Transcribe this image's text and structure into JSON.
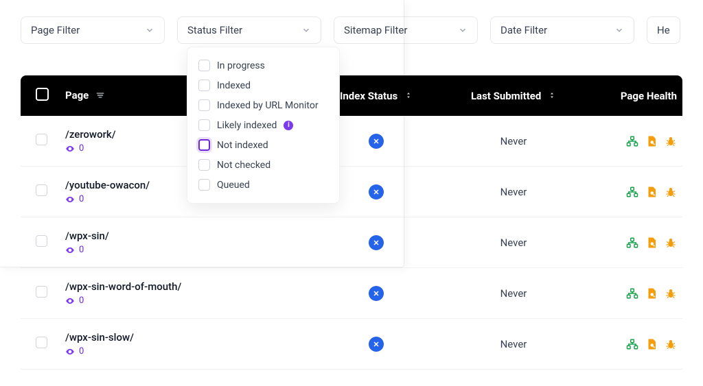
{
  "filters": {
    "page": "Page Filter",
    "status": "Status Filter",
    "sitemap": "Sitemap Filter",
    "date": "Date Filter",
    "extra": "He"
  },
  "status_options": [
    {
      "label": "In progress",
      "focused": false,
      "info": false
    },
    {
      "label": "Indexed",
      "focused": false,
      "info": false
    },
    {
      "label": "Indexed by URL Monitor",
      "focused": false,
      "info": false
    },
    {
      "label": "Likely indexed",
      "focused": false,
      "info": true
    },
    {
      "label": "Not indexed",
      "focused": true,
      "info": false
    },
    {
      "label": "Not checked",
      "focused": false,
      "info": false
    },
    {
      "label": "Queued",
      "focused": false,
      "info": false
    }
  ],
  "columns": {
    "page": "Page",
    "index_status": "Index Status",
    "last_submitted": "Last Submitted",
    "page_health": "Page Health"
  },
  "rows": [
    {
      "path": "/zerowork/",
      "views": "0",
      "last_submitted": "Never"
    },
    {
      "path": "/youtube-owacon/",
      "views": "0",
      "last_submitted": "Never"
    },
    {
      "path": "/wpx-sin/",
      "views": "0",
      "last_submitted": "Never"
    },
    {
      "path": "/wpx-sin-word-of-mouth/",
      "views": "0",
      "last_submitted": "Never"
    },
    {
      "path": "/wpx-sin-slow/",
      "views": "0",
      "last_submitted": "Never"
    }
  ],
  "icons": {
    "info_glyph": "i"
  }
}
